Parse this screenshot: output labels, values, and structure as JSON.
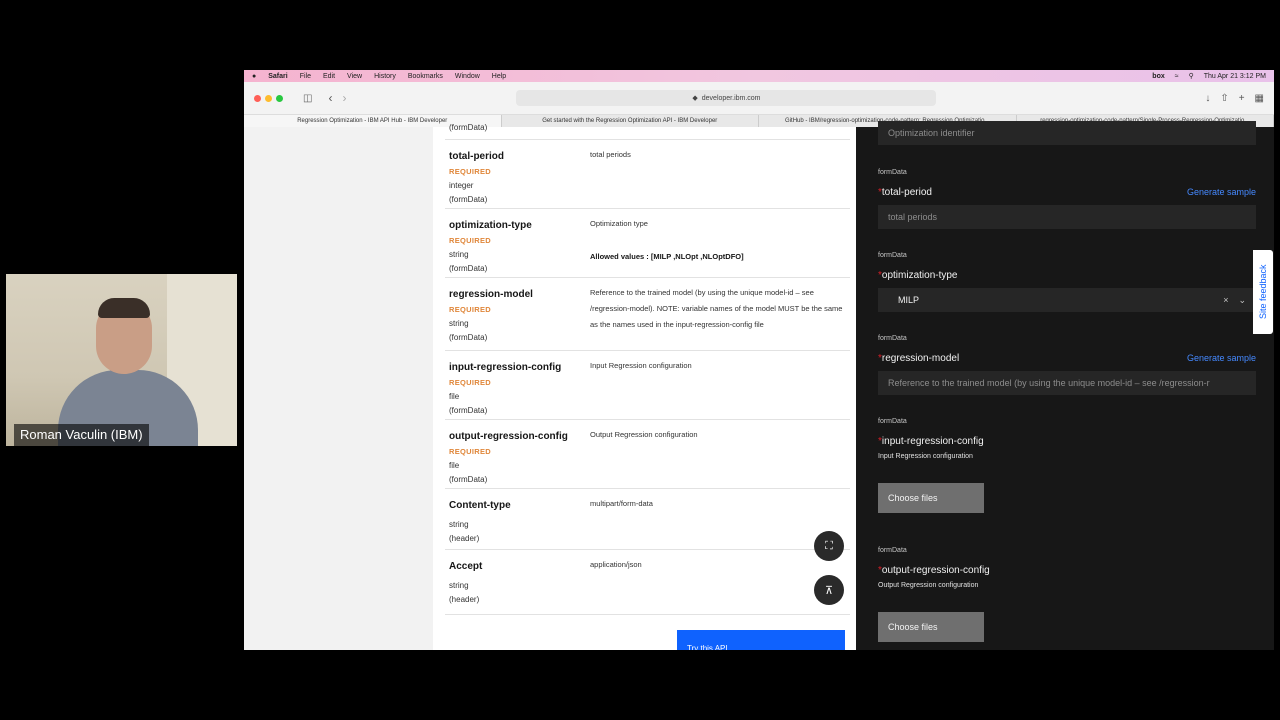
{
  "video": {
    "participant_name": "Roman Vaculin (IBM)"
  },
  "menubar": {
    "items": [
      "Safari",
      "File",
      "Edit",
      "View",
      "History",
      "Bookmarks",
      "Window",
      "Help"
    ],
    "box_label": "box",
    "datetime": "Thu Apr 21  3:12 PM"
  },
  "browser": {
    "address": "developer.ibm.com",
    "tabs": [
      "Regression Optimization - IBM API Hub - IBM Developer",
      "Get started with the Regression Optimization API - IBM Developer",
      "GitHub - IBM/regression-optimization-code-pattern: Regression Optimizatio...",
      "regression-optimization-code-pattern/Single-Process-Regression-Optimizatio..."
    ]
  },
  "params": {
    "top_fragment": "(formData)",
    "rows": [
      {
        "name": "total-period",
        "required": "REQUIRED",
        "type": "integer",
        "in": "(formData)",
        "desc": "total periods",
        "allowed": ""
      },
      {
        "name": "optimization-type",
        "required": "REQUIRED",
        "type": "string",
        "in": "(formData)",
        "desc": "Optimization type",
        "allowed": "Allowed values : [MILP ,NLOpt ,NLOptDFO]"
      },
      {
        "name": "regression-model",
        "required": "REQUIRED",
        "type": "string",
        "in": "(formData)",
        "desc": "Reference to the trained model (by using the unique model-id – see /regression-model). NOTE: variable names of the model MUST be the same as the names used in the input-regression-config file",
        "allowed": ""
      },
      {
        "name": "input-regression-config",
        "required": "REQUIRED",
        "type": "file",
        "in": "(formData)",
        "desc": "Input Regression configuration",
        "allowed": ""
      },
      {
        "name": "output-regression-config",
        "required": "REQUIRED",
        "type": "file",
        "in": "(formData)",
        "desc": "Output Regression configuration",
        "allowed": ""
      },
      {
        "name": "Content-type",
        "required": "",
        "type": "string",
        "in": "(header)",
        "desc": "multipart/form-data",
        "allowed": ""
      },
      {
        "name": "Accept",
        "required": "",
        "type": "string",
        "in": "(header)",
        "desc": "application/json",
        "allowed": ""
      }
    ],
    "try_button": "Try this API"
  },
  "form": {
    "top_placeholder": "Optimization identifier",
    "formdata_label": "formData",
    "generate_label": "Generate sample",
    "total_period": {
      "label": "total-period",
      "placeholder": "total periods"
    },
    "optimization_type": {
      "label": "optimization-type",
      "value": "MILP"
    },
    "regression_model": {
      "label": "regression-model",
      "placeholder": "Reference to the trained model (by using the unique model-id – see /regression-r"
    },
    "input_config": {
      "label": "input-regression-config",
      "desc": "Input Regression configuration",
      "button": "Choose files"
    },
    "output_config": {
      "label": "output-regression-config",
      "desc": "Output Regression configuration",
      "button": "Choose files"
    }
  },
  "site_feedback": "Site feedback"
}
